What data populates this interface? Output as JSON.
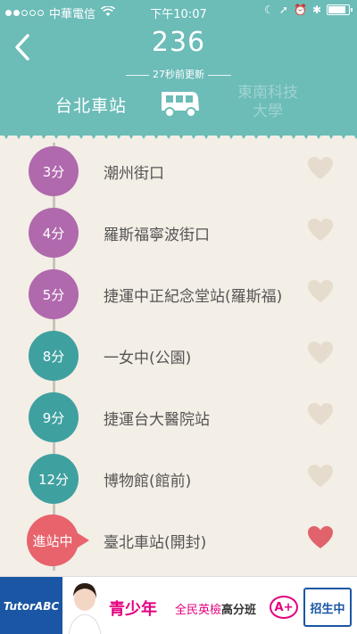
{
  "status_bar": {
    "carrier": "中華電信",
    "time": "下午10:07",
    "signal_bars_filled": 2,
    "signal_bars_total": 5
  },
  "header": {
    "route_number": "236",
    "updated_text": "27秒前更新",
    "destination_left": "台北車站",
    "destination_right_line1": "東南科技",
    "destination_right_line2": "大學",
    "accent_color": "#6cbcb8"
  },
  "stops": [
    {
      "eta": "3分",
      "name": "潮州街口",
      "color": "purple",
      "favorite": false
    },
    {
      "eta": "4分",
      "name": "羅斯福寧波街口",
      "color": "purple",
      "favorite": false
    },
    {
      "eta": "5分",
      "name": "捷運中正紀念堂站(羅斯福)",
      "color": "purple",
      "favorite": false
    },
    {
      "eta": "8分",
      "name": "一女中(公園)",
      "color": "teal",
      "favorite": false
    },
    {
      "eta": "9分",
      "name": "捷運台大醫院站",
      "color": "teal",
      "favorite": false
    },
    {
      "eta": "12分",
      "name": "博物館(館前)",
      "color": "teal",
      "favorite": false
    },
    {
      "eta": "進站中",
      "name": "臺北車站(開封)",
      "color": "arriving",
      "favorite": true
    }
  ],
  "colors": {
    "purple": "#b069ad",
    "teal": "#3fa0a0",
    "arriving": "#e8636c",
    "heart_off": "#e6dccd",
    "heart_on": "#e0636b"
  },
  "ad": {
    "logo": "TutorABC",
    "headline": "青少年",
    "subline_a": "全民英檢",
    "subline_b": "高分班",
    "badge": "A+",
    "cta": "招生中"
  }
}
